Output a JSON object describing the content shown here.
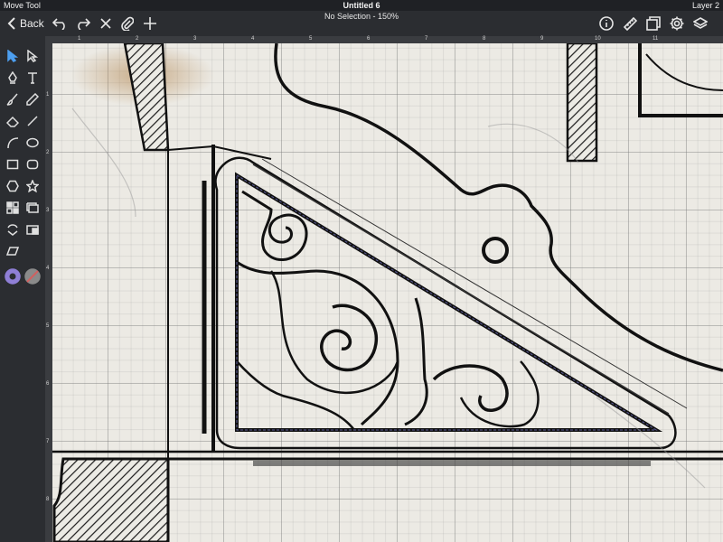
{
  "status": {
    "tool": "Move Tool",
    "title": "Untitled 6",
    "layer": "Layer 2"
  },
  "nav": {
    "back_label": "Back",
    "subtitle": "No Selection - 150%"
  },
  "ruler": {
    "top_marks": [
      "1",
      "2",
      "3",
      "4",
      "5",
      "6",
      "7",
      "8",
      "9",
      "10",
      "11"
    ],
    "left_marks": [
      "1",
      "2",
      "3",
      "4",
      "5",
      "6",
      "7",
      "8"
    ]
  },
  "colors": {
    "accent": "#4d9ff0",
    "fill_swatch": "#8f7fd6",
    "stroke_swatch": "#d06060"
  }
}
